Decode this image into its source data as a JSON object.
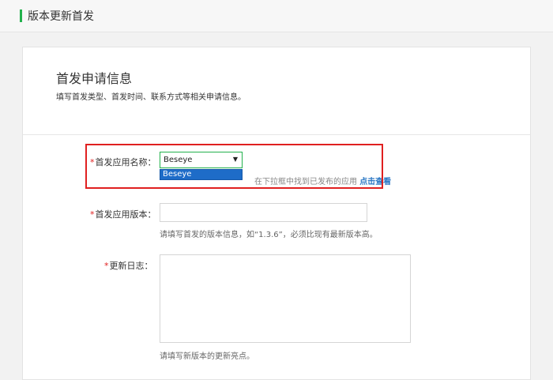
{
  "header": {
    "title": "版本更新首发"
  },
  "section": {
    "title": "首发申请信息",
    "subtitle": "填写首发类型、首发时间、联系方式等相关申请信息。"
  },
  "fields": {
    "app_name": {
      "required_mark": "*",
      "label": "首发应用名称：",
      "selected": "Beseye",
      "options": [
        "Beseye"
      ],
      "hint_prefix": "请选择已发布的应用，如未在下拉框中找到已发布的应用",
      "hint_visible": "在下拉框中找到已发布的应用",
      "hint_link": "点击查看"
    },
    "app_version": {
      "required_mark": "*",
      "label": "首发应用版本：",
      "value": "",
      "hint": "请填写首发的版本信息，如“1.3.6”，必须比现有最新版本高。"
    },
    "changelog": {
      "required_mark": "*",
      "label": "更新日志：",
      "value": "",
      "hint": "请填写新版本的更新亮点。"
    }
  },
  "colors": {
    "accent": "#22b14c",
    "required": "#e02020",
    "link": "#2b78c5",
    "dropdown_highlight": "#1e6cc8"
  }
}
